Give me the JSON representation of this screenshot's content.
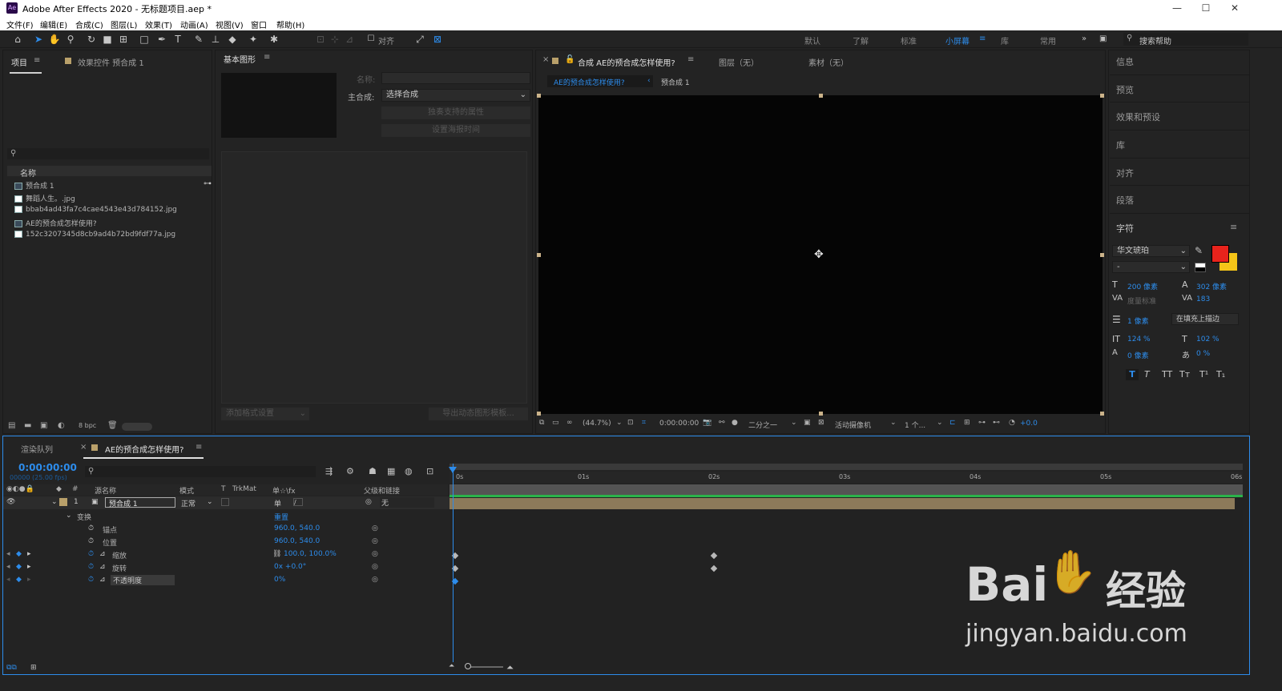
{
  "titlebar": {
    "icon": "Ae",
    "title": "Adobe After Effects 2020 - 无标题项目.aep *",
    "min": "—",
    "max": "☐",
    "close": "✕"
  },
  "menu": [
    "文件(F)",
    "编辑(E)",
    "合成(C)",
    "图层(L)",
    "效果(T)",
    "动画(A)",
    "视图(V)",
    "窗口",
    "帮助(H)"
  ],
  "toolbar": {
    "align_label": "对齐",
    "workspaces": [
      "默认",
      "了解",
      "标准",
      "小屏幕",
      "库",
      "常用"
    ],
    "active_workspace": "小屏幕",
    "search_placeholder": "搜索帮助"
  },
  "project": {
    "tab": "项目",
    "effects_tab": "效果控件 预合成 1",
    "column": "名称",
    "items": [
      "预合成 1",
      "舞蹈人生。.jpg",
      "bbab4ad43fa7c4cae4543e43d784152.jpg",
      "AE的预合成怎样使用?",
      "152c3207345d8cb9ad4b72bd9fdf77a.jpg"
    ],
    "bpc": "8 bpc"
  },
  "essential": {
    "tab": "基本图形",
    "name_label": "名称:",
    "master_label": "主合成:",
    "master_value": "选择合成",
    "btn1": "独奏支持的属性",
    "btn2": "设置海报时间",
    "footer_left": "添加格式设置",
    "footer_right": "导出动态图形模板..."
  },
  "comp": {
    "tab": "合成 AE的预合成怎样使用?",
    "layer_tab": "图层（无）",
    "footage_tab": "素材（无）",
    "breadcrumb1": "AE的预合成怎样使用?",
    "breadcrumb2": "预合成 1",
    "zoom": "(44.7%)",
    "time": "0:00:00:00",
    "resolution": "二分之一",
    "camera": "活动摄像机",
    "views": "1 个...",
    "exposure": "+0.0"
  },
  "rightpanel": {
    "items": [
      "信息",
      "预览",
      "效果和预设",
      "库",
      "对齐",
      "段落"
    ],
    "char_title": "字符",
    "font": "华文琥珀",
    "style": "-",
    "size": "200 像素",
    "leading": "302 像素",
    "kerning": "度量标准",
    "tracking": "183",
    "stroke": "1 像素",
    "stroke_mode": "在填充上描边",
    "vscale": "124 %",
    "hscale": "102 %",
    "baseline": "0 像素",
    "tsume": "0 %",
    "fill_color": "#e8231c",
    "stroke_color": "#f5c518"
  },
  "timeline": {
    "render_tab": "渲染队列",
    "comp_tab": "AE的预合成怎样使用?",
    "timecode": "0:00:00:00",
    "fps": "00000 (25.00 fps)",
    "cols": {
      "src": "源名称",
      "mode": "模式",
      "t": "T",
      "trkmat": "TrkMat",
      "switches": "单☆\\fx",
      "parent": "父级和链接"
    },
    "layer": {
      "num": "1",
      "name": "预合成 1",
      "mode": "正常",
      "parent": "无"
    },
    "transform": "变换",
    "reset": "重置",
    "props": [
      {
        "name": "锚点",
        "value": "960.0, 540.0"
      },
      {
        "name": "位置",
        "value": "960.0, 540.0"
      },
      {
        "name": "缩放",
        "value": "100.0, 100.0%"
      },
      {
        "name": "旋转",
        "value": "0x +0.0°"
      },
      {
        "name": "不透明度",
        "value": "0%"
      }
    ],
    "ruler": [
      "0s",
      "01s",
      "02s",
      "03s",
      "04s",
      "05s",
      "06s"
    ]
  },
  "watermark": {
    "brand": "Bai",
    "brand2": "经验",
    "url": "jingyan.baidu.com"
  }
}
